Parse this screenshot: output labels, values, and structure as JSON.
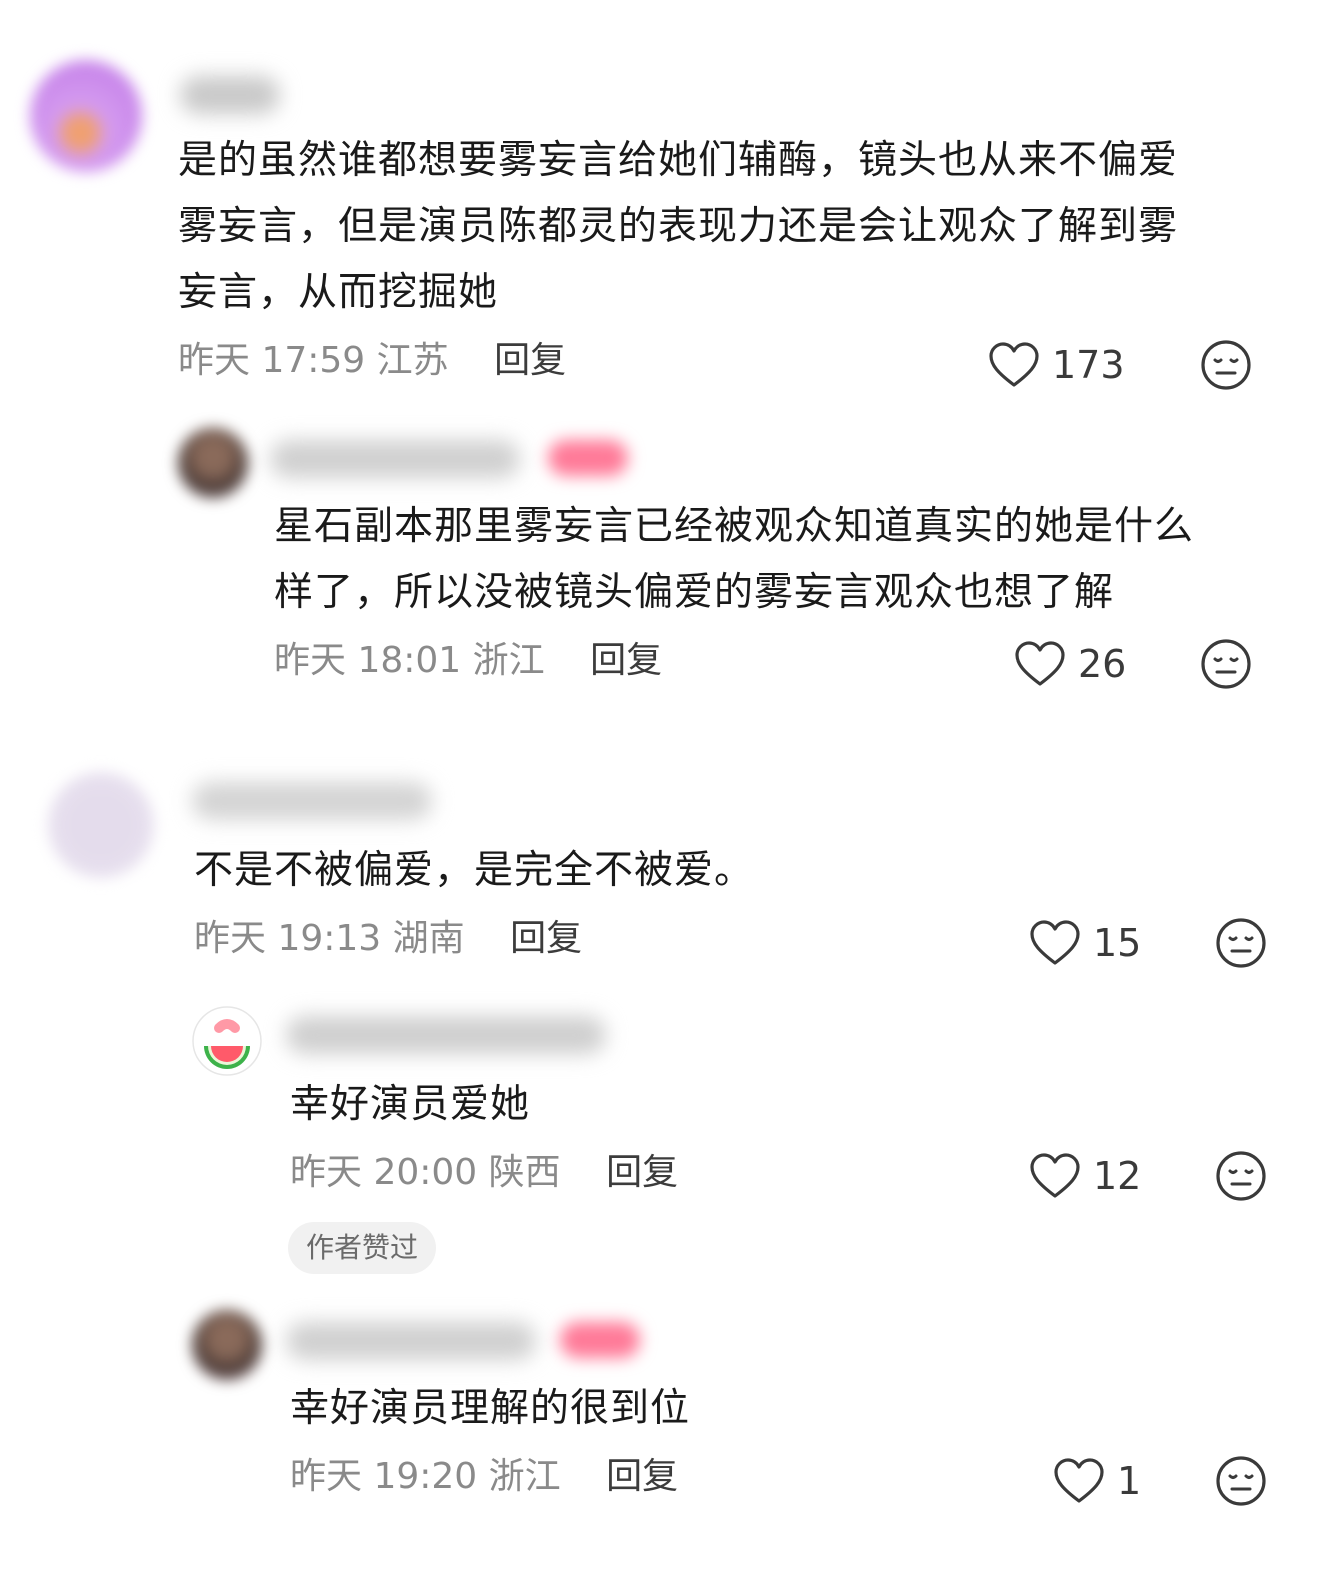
{
  "comments": [
    {
      "text_lines": [
        "是的虽然谁都想要雾妄言给她们辅酶，镜头也从来不偏爱",
        "雾妄言，但是演员陈都灵的表现力还是会让观众了解到雾",
        "妄言，从而挖掘她"
      ],
      "time": "昨天 17:59",
      "location": "江苏",
      "reply_label": "回复",
      "likes": "173"
    },
    {
      "text_lines": [
        "星石副本那里雾妄言已经被观众知道真实的她是什么",
        "样了，所以没被镜头偏爱的雾妄言观众也想了解"
      ],
      "time": "昨天 18:01",
      "location": "浙江",
      "reply_label": "回复",
      "likes": "26"
    },
    {
      "text_lines": [
        "不是不被偏爱，是完全不被爱。"
      ],
      "time": "昨天 19:13",
      "location": "湖南",
      "reply_label": "回复",
      "likes": "15"
    },
    {
      "text_lines": [
        "幸好演员爱她"
      ],
      "time": "昨天 20:00",
      "location": "陕西",
      "reply_label": "回复",
      "likes": "12",
      "badge": "作者赞过"
    },
    {
      "text_lines": [
        "幸好演员理解的很到位"
      ],
      "time": "昨天 19:20",
      "location": "浙江",
      "reply_label": "回复",
      "likes": "1"
    }
  ],
  "icons": {
    "like": "heart-outline-icon",
    "dislike": "neutral-face-icon"
  },
  "colors": {
    "text": "#1a1a1a",
    "meta": "#8a8a8a",
    "reply": "#3c3c3c"
  }
}
